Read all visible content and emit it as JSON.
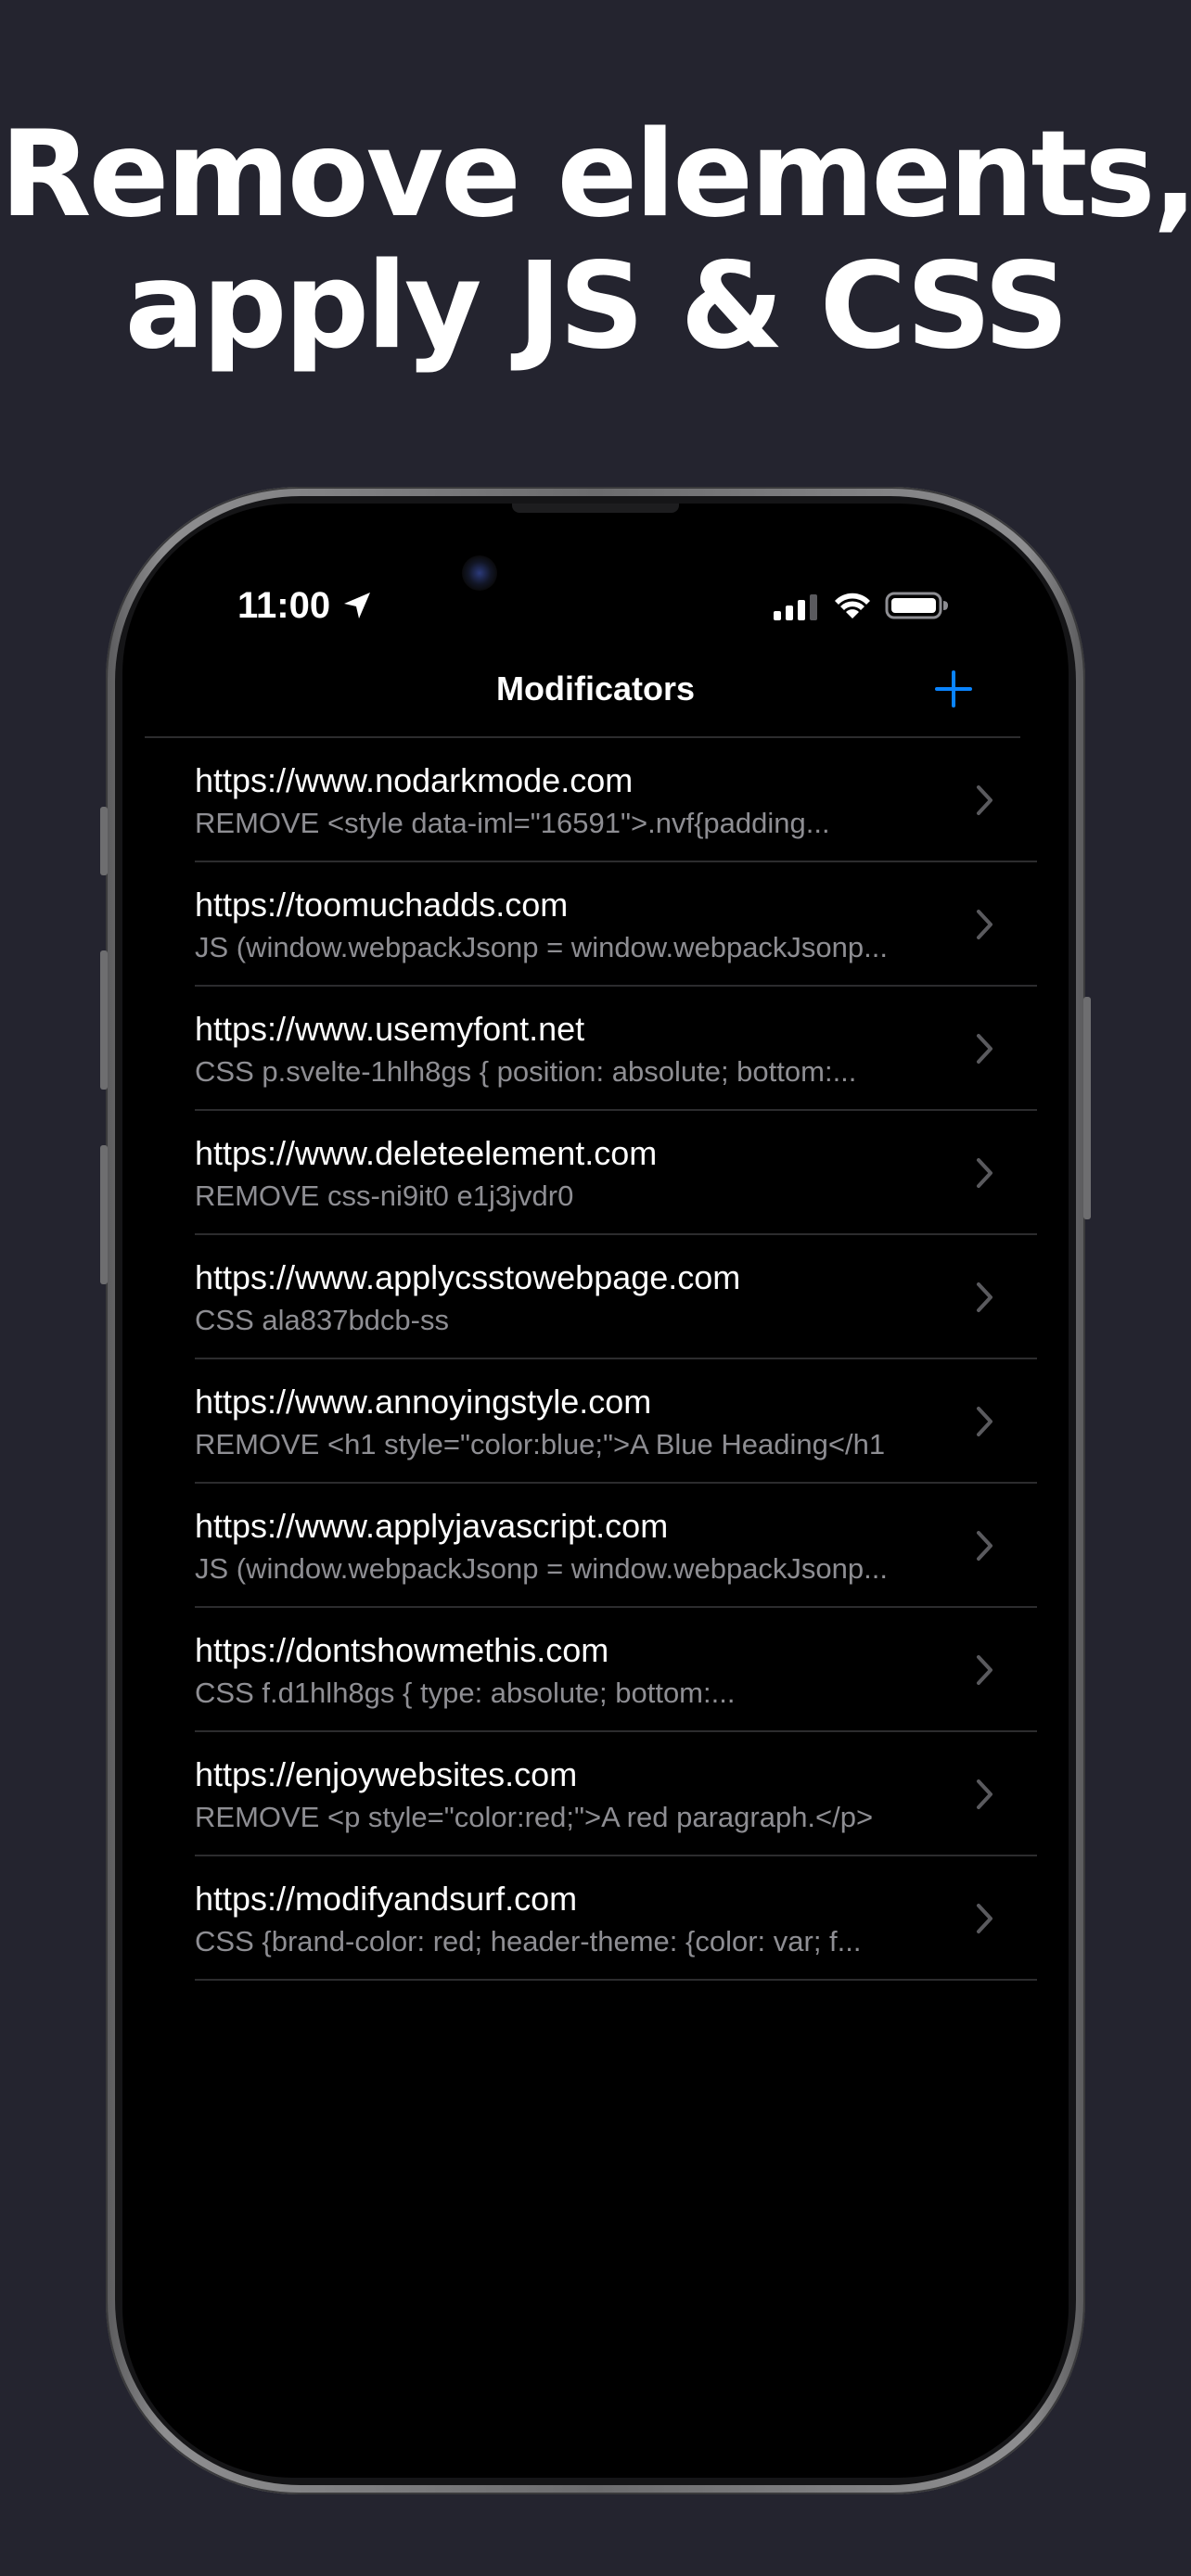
{
  "headline": {
    "line1": "Remove elements,",
    "line2": "apply JS & CSS"
  },
  "status_bar": {
    "time": "11:00",
    "icons": [
      "location-arrow-icon",
      "cellular-signal-icon",
      "wifi-icon",
      "battery-icon"
    ]
  },
  "nav": {
    "title": "Modificators",
    "add_icon": "plus-icon"
  },
  "colors": {
    "background": "#24242f",
    "accent": "#0a84ff",
    "secondary_text": "#8e8e93",
    "screen": "#000000"
  },
  "items": [
    {
      "url": "https://www.nodarkmode.com",
      "detail": "REMOVE <style data-iml=\"16591\">.nvf{padding..."
    },
    {
      "url": "https://toomuchadds.com",
      "detail": "JS (window.webpackJsonp = window.webpackJsonp..."
    },
    {
      "url": "https://www.usemyfont.net",
      "detail": "CSS p.svelte-1hlh8gs { position: absolute; bottom:..."
    },
    {
      "url": "https://www.deleteelement.com",
      "detail": "REMOVE css-ni9it0 e1j3jvdr0"
    },
    {
      "url": "https://www.applycsstowebpage.com",
      "detail": "CSS ala837bdcb-ss"
    },
    {
      "url": "https://www.annoyingstyle.com",
      "detail": "REMOVE <h1 style=\"color:blue;\">A Blue Heading</h1"
    },
    {
      "url": "https://www.applyjavascript.com",
      "detail": "JS (window.webpackJsonp = window.webpackJsonp..."
    },
    {
      "url": "https://dontshowmethis.com",
      "detail": "CSS f.d1hlh8gs { type: absolute; bottom:..."
    },
    {
      "url": "https://enjoywebsites.com",
      "detail": "REMOVE <p style=\"color:red;\">A red paragraph.</p>"
    },
    {
      "url": "https://modifyandsurf.com",
      "detail": "CSS {brand-color: red; header-theme: {color: var; f..."
    }
  ]
}
